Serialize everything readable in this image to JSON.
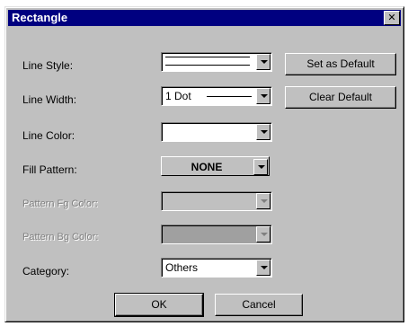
{
  "window": {
    "title": "Rectangle",
    "close_glyph": "✕"
  },
  "labels": {
    "line_style": "Line Style:",
    "line_width": "Line Width:",
    "line_color": "Line Color:",
    "fill_pattern": "Fill Pattern:",
    "pattern_fg_color": "Pattern Fg Color:",
    "pattern_bg_color": "Pattern Bg Color:",
    "category": "Category:"
  },
  "values": {
    "line_width": "1 Dot",
    "fill_pattern": "NONE",
    "category": "Others"
  },
  "buttons": {
    "set_default": "Set as Default",
    "clear_default": "Clear Default",
    "ok": "OK",
    "cancel": "Cancel"
  },
  "icons": {
    "close": "close-icon",
    "dropdown": "chevron-down-icon"
  }
}
